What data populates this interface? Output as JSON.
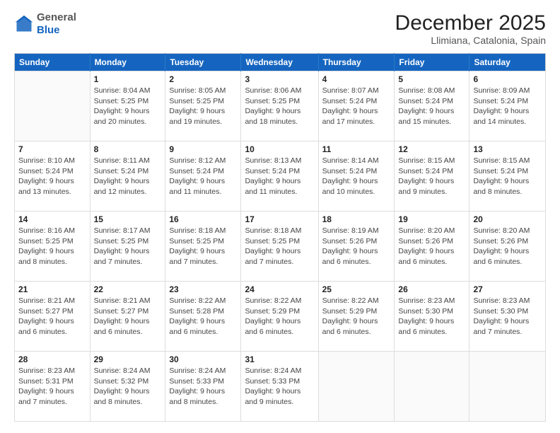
{
  "logo": {
    "general": "General",
    "blue": "Blue"
  },
  "title": "December 2025",
  "location": "Llimiana, Catalonia, Spain",
  "days_of_week": [
    "Sunday",
    "Monday",
    "Tuesday",
    "Wednesday",
    "Thursday",
    "Friday",
    "Saturday"
  ],
  "weeks": [
    [
      {
        "day": "",
        "info": ""
      },
      {
        "day": "1",
        "info": "Sunrise: 8:04 AM\nSunset: 5:25 PM\nDaylight: 9 hours\nand 20 minutes."
      },
      {
        "day": "2",
        "info": "Sunrise: 8:05 AM\nSunset: 5:25 PM\nDaylight: 9 hours\nand 19 minutes."
      },
      {
        "day": "3",
        "info": "Sunrise: 8:06 AM\nSunset: 5:25 PM\nDaylight: 9 hours\nand 18 minutes."
      },
      {
        "day": "4",
        "info": "Sunrise: 8:07 AM\nSunset: 5:24 PM\nDaylight: 9 hours\nand 17 minutes."
      },
      {
        "day": "5",
        "info": "Sunrise: 8:08 AM\nSunset: 5:24 PM\nDaylight: 9 hours\nand 15 minutes."
      },
      {
        "day": "6",
        "info": "Sunrise: 8:09 AM\nSunset: 5:24 PM\nDaylight: 9 hours\nand 14 minutes."
      }
    ],
    [
      {
        "day": "7",
        "info": "Sunrise: 8:10 AM\nSunset: 5:24 PM\nDaylight: 9 hours\nand 13 minutes."
      },
      {
        "day": "8",
        "info": "Sunrise: 8:11 AM\nSunset: 5:24 PM\nDaylight: 9 hours\nand 12 minutes."
      },
      {
        "day": "9",
        "info": "Sunrise: 8:12 AM\nSunset: 5:24 PM\nDaylight: 9 hours\nand 11 minutes."
      },
      {
        "day": "10",
        "info": "Sunrise: 8:13 AM\nSunset: 5:24 PM\nDaylight: 9 hours\nand 11 minutes."
      },
      {
        "day": "11",
        "info": "Sunrise: 8:14 AM\nSunset: 5:24 PM\nDaylight: 9 hours\nand 10 minutes."
      },
      {
        "day": "12",
        "info": "Sunrise: 8:15 AM\nSunset: 5:24 PM\nDaylight: 9 hours\nand 9 minutes."
      },
      {
        "day": "13",
        "info": "Sunrise: 8:15 AM\nSunset: 5:24 PM\nDaylight: 9 hours\nand 8 minutes."
      }
    ],
    [
      {
        "day": "14",
        "info": "Sunrise: 8:16 AM\nSunset: 5:25 PM\nDaylight: 9 hours\nand 8 minutes."
      },
      {
        "day": "15",
        "info": "Sunrise: 8:17 AM\nSunset: 5:25 PM\nDaylight: 9 hours\nand 7 minutes."
      },
      {
        "day": "16",
        "info": "Sunrise: 8:18 AM\nSunset: 5:25 PM\nDaylight: 9 hours\nand 7 minutes."
      },
      {
        "day": "17",
        "info": "Sunrise: 8:18 AM\nSunset: 5:25 PM\nDaylight: 9 hours\nand 7 minutes."
      },
      {
        "day": "18",
        "info": "Sunrise: 8:19 AM\nSunset: 5:26 PM\nDaylight: 9 hours\nand 6 minutes."
      },
      {
        "day": "19",
        "info": "Sunrise: 8:20 AM\nSunset: 5:26 PM\nDaylight: 9 hours\nand 6 minutes."
      },
      {
        "day": "20",
        "info": "Sunrise: 8:20 AM\nSunset: 5:26 PM\nDaylight: 9 hours\nand 6 minutes."
      }
    ],
    [
      {
        "day": "21",
        "info": "Sunrise: 8:21 AM\nSunset: 5:27 PM\nDaylight: 9 hours\nand 6 minutes."
      },
      {
        "day": "22",
        "info": "Sunrise: 8:21 AM\nSunset: 5:27 PM\nDaylight: 9 hours\nand 6 minutes."
      },
      {
        "day": "23",
        "info": "Sunrise: 8:22 AM\nSunset: 5:28 PM\nDaylight: 9 hours\nand 6 minutes."
      },
      {
        "day": "24",
        "info": "Sunrise: 8:22 AM\nSunset: 5:29 PM\nDaylight: 9 hours\nand 6 minutes."
      },
      {
        "day": "25",
        "info": "Sunrise: 8:22 AM\nSunset: 5:29 PM\nDaylight: 9 hours\nand 6 minutes."
      },
      {
        "day": "26",
        "info": "Sunrise: 8:23 AM\nSunset: 5:30 PM\nDaylight: 9 hours\nand 6 minutes."
      },
      {
        "day": "27",
        "info": "Sunrise: 8:23 AM\nSunset: 5:30 PM\nDaylight: 9 hours\nand 7 minutes."
      }
    ],
    [
      {
        "day": "28",
        "info": "Sunrise: 8:23 AM\nSunset: 5:31 PM\nDaylight: 9 hours\nand 7 minutes."
      },
      {
        "day": "29",
        "info": "Sunrise: 8:24 AM\nSunset: 5:32 PM\nDaylight: 9 hours\nand 8 minutes."
      },
      {
        "day": "30",
        "info": "Sunrise: 8:24 AM\nSunset: 5:33 PM\nDaylight: 9 hours\nand 8 minutes."
      },
      {
        "day": "31",
        "info": "Sunrise: 8:24 AM\nSunset: 5:33 PM\nDaylight: 9 hours\nand 9 minutes."
      },
      {
        "day": "",
        "info": ""
      },
      {
        "day": "",
        "info": ""
      },
      {
        "day": "",
        "info": ""
      }
    ]
  ]
}
